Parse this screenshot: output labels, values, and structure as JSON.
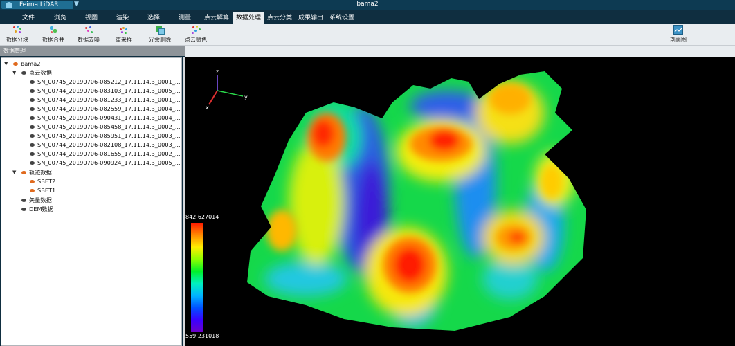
{
  "app": {
    "brand": "Feima LiDAR",
    "dropdown_glyph": "▼",
    "window_title": "bama2",
    "brand_color": "#1f6e93",
    "titlebar_color": "#0d3a52"
  },
  "menu": {
    "items": [
      "文件",
      "浏览",
      "视图",
      "渲染",
      "选择",
      "测量",
      "点云解算",
      "数据处理",
      "点云分类",
      "成果输出",
      "系统设置"
    ],
    "active_index": 7
  },
  "toolbar": {
    "tools": [
      {
        "label": "数据分块",
        "icon": "data-tiling-icon"
      },
      {
        "label": "数据合并",
        "icon": "data-merge-icon"
      },
      {
        "label": "数据去噪",
        "icon": "data-denoise-icon"
      },
      {
        "label": "重采样",
        "icon": "resample-icon"
      },
      {
        "label": "冗余删除",
        "icon": "redundancy-delete-icon"
      },
      {
        "label": "点云赋色",
        "icon": "point-cloud-colorize-icon"
      }
    ],
    "right_tool": {
      "label": "剖面图",
      "icon": "profile-icon"
    }
  },
  "panel": {
    "title": "数据管理"
  },
  "tree": {
    "root": "bama2",
    "point_cloud_group": "点云数据",
    "point_cloud_files": [
      "SN_00745_20190706-085212_17.11.14.3_0001_...",
      "SN_00744_20190706-083103_17.11.14.3_0005_...",
      "SN_00744_20190706-081233_17.11.14.3_0001_...",
      "SN_00744_20190706-082559_17.11.14.3_0004_...",
      "SN_00745_20190706-090431_17.11.14.3_0004_...",
      "SN_00745_20190706-085458_17.11.14.3_0002_...",
      "SN_00745_20190706-085951_17.11.14.3_0003_...",
      "SN_00744_20190706-082108_17.11.14.3_0003_...",
      "SN_00744_20190706-081655_17.11.14.3_0002_...",
      "SN_00745_20190706-090924_17.11.14.3_0005_..."
    ],
    "trajectory_group": "轨迹数据",
    "trajectory_files": [
      "SBET2",
      "SBET1"
    ],
    "vector_group": "矢量数据",
    "dem_group": "DEM数据",
    "expand_glyph": "▼"
  },
  "viewport": {
    "elevation_max": "842.627014",
    "elevation_min": "559.231018",
    "axis_labels": {
      "x": "x",
      "y": "y",
      "z": "z"
    }
  }
}
